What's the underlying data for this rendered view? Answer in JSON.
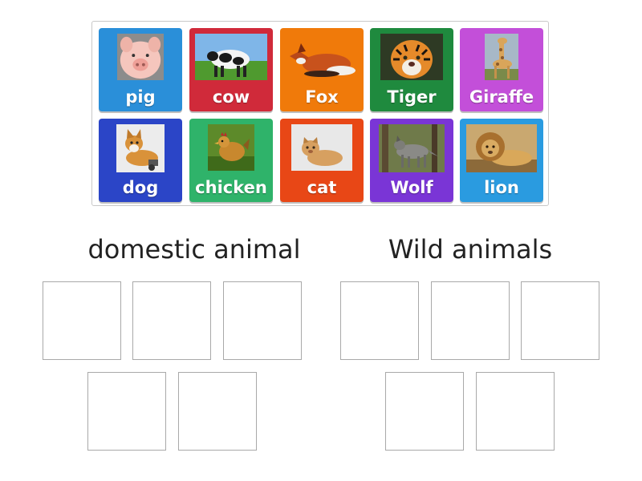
{
  "tiles": [
    {
      "label": "pig",
      "color": "#2a8fd9",
      "icon": "pig-photo"
    },
    {
      "label": "cow",
      "color": "#d02a3a",
      "icon": "cow-photo"
    },
    {
      "label": "Fox",
      "color": "#f07a0a",
      "icon": "fox-photo"
    },
    {
      "label": "Tiger",
      "color": "#1f8a3e",
      "icon": "tiger-photo"
    },
    {
      "label": "Giraffe",
      "color": "#c34fd9",
      "icon": "giraffe-photo"
    },
    {
      "label": "dog",
      "color": "#2b45c7",
      "icon": "dog-photo"
    },
    {
      "label": "chicken",
      "color": "#2fb36a",
      "icon": "chicken-photo"
    },
    {
      "label": "cat",
      "color": "#e84716",
      "icon": "cat-photo"
    },
    {
      "label": "Wolf",
      "color": "#7a35d6",
      "icon": "wolf-photo"
    },
    {
      "label": "lion",
      "color": "#2a9be0",
      "icon": "lion-photo"
    }
  ],
  "groups": [
    {
      "title": "domestic animal",
      "slots": 5
    },
    {
      "title": "Wild animals",
      "slots": 5
    }
  ]
}
